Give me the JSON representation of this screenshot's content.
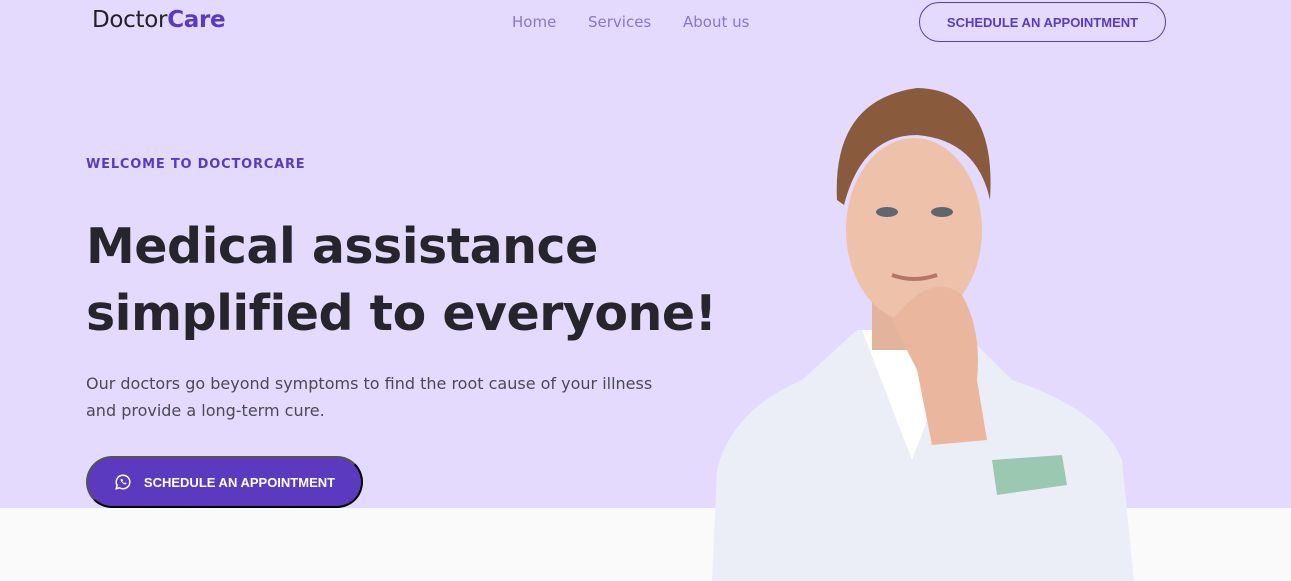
{
  "header": {
    "logo_part1": "Doctor",
    "logo_part2": "Care",
    "nav": [
      "Home",
      "Services",
      "About us"
    ],
    "cta_label": "SCHEDULE AN APPOINTMENT"
  },
  "hero": {
    "kicker": "WELCOME TO DOCTORCARE",
    "title_line1": "Medical assistance",
    "title_line2": "simplified to everyone!",
    "description_line1": "Our doctors go beyond symptoms to find the root cause of your illness",
    "description_line2": "and provide a long-term cure.",
    "cta_label": "SCHEDULE AN APPOINTMENT",
    "cta_icon": "whatsapp-icon"
  },
  "colors": {
    "accent": "#5b3ac0",
    "hero_bg": "#e4dafe",
    "text": "#26252b"
  }
}
